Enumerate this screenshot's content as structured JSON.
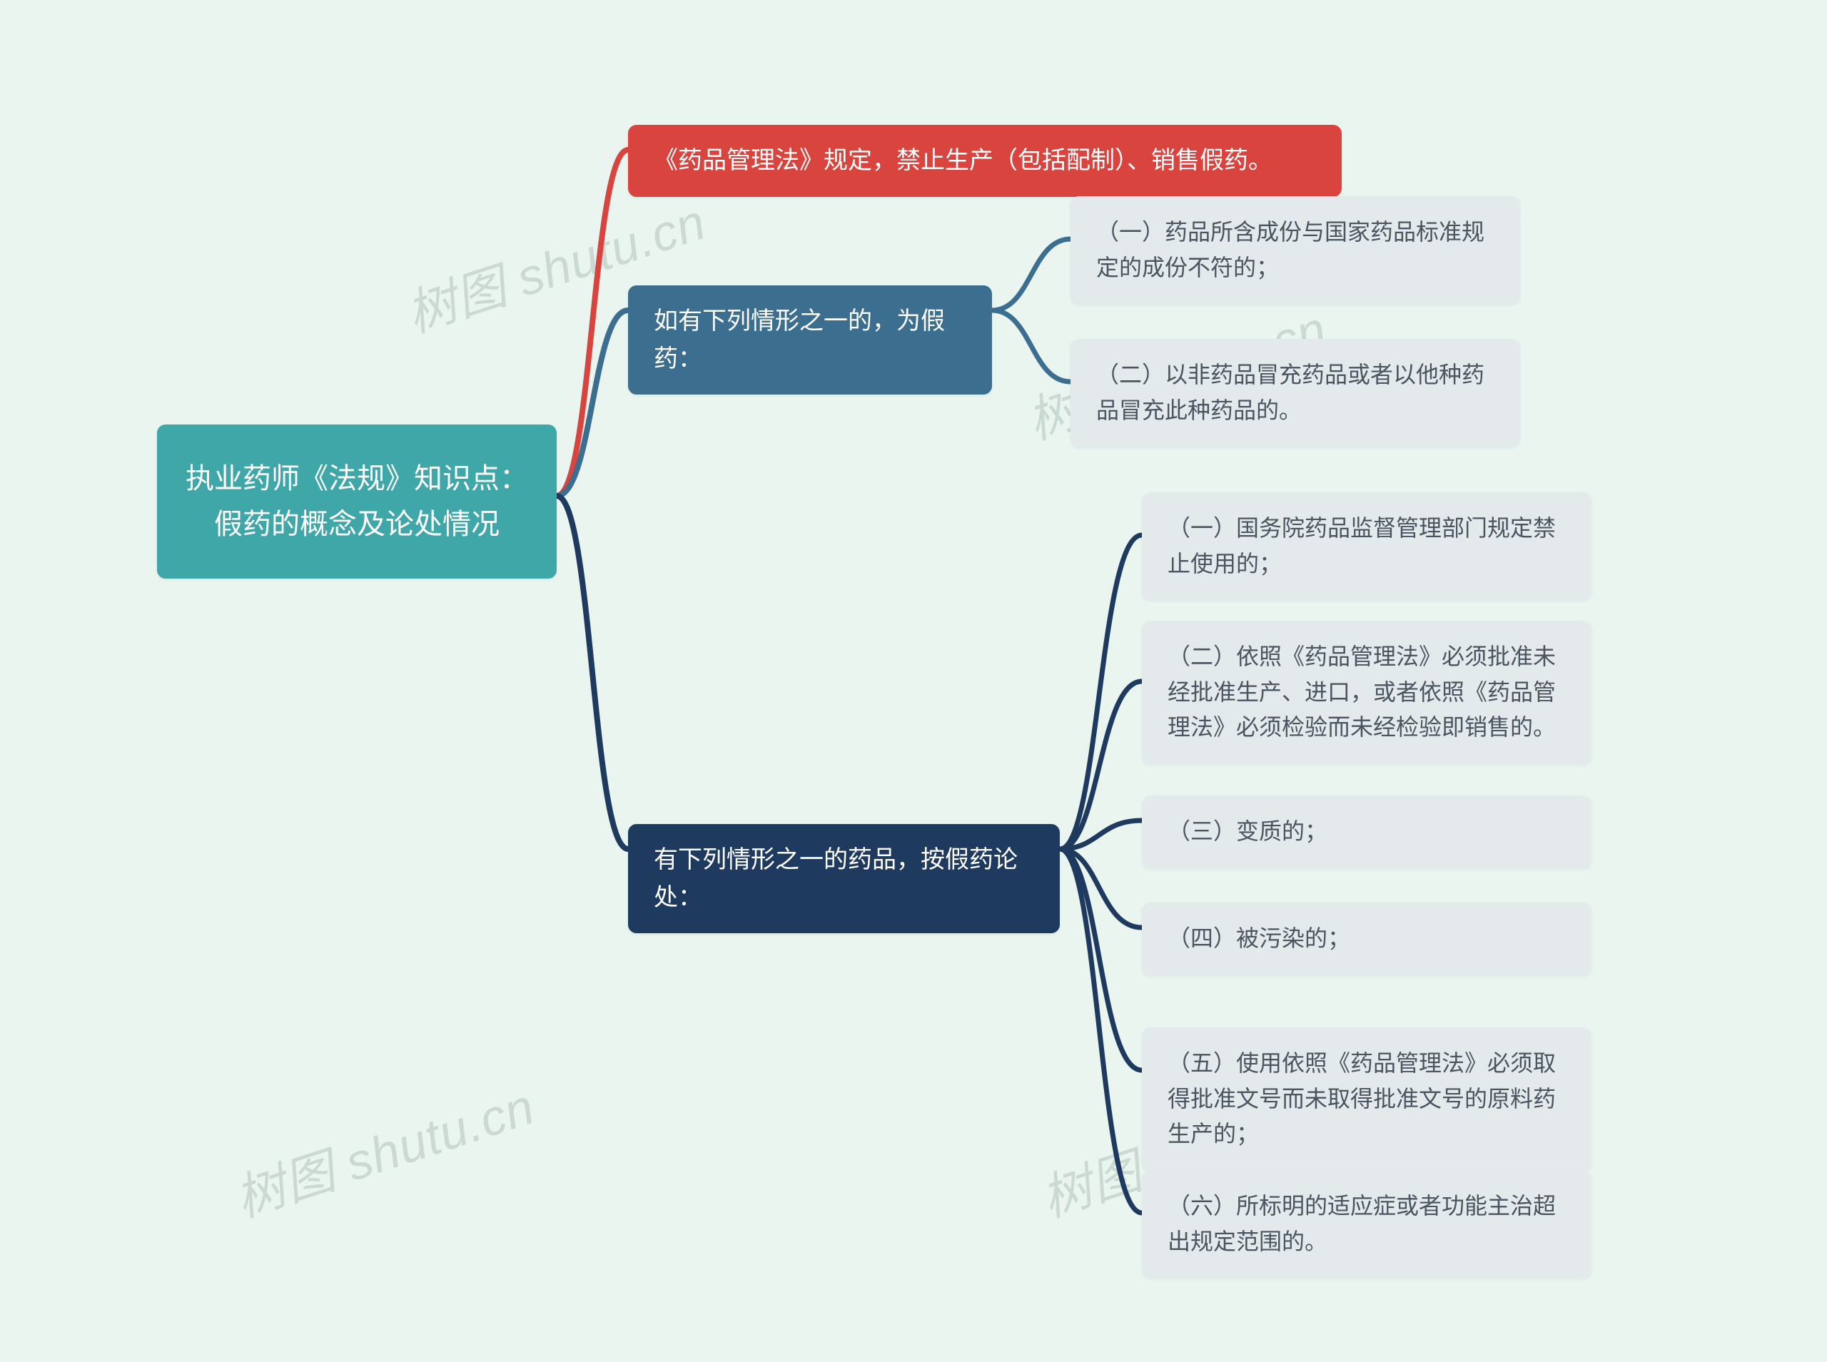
{
  "root": {
    "title": "执业药师《法规》知识点：假药的概念及论处情况"
  },
  "branches": [
    {
      "id": "b1",
      "color": "red",
      "label": "《药品管理法》规定，禁止生产（包括配制）、销售假药。",
      "children": []
    },
    {
      "id": "b2",
      "color": "blue",
      "label": "如有下列情形之一的，为假药：",
      "children": [
        {
          "id": "b2c1",
          "text": "（一）药品所含成份与国家药品标准规定的成份不符的；"
        },
        {
          "id": "b2c2",
          "text": "（二）以非药品冒充药品或者以他种药品冒充此种药品的。"
        }
      ]
    },
    {
      "id": "b3",
      "color": "navy",
      "label": "有下列情形之一的药品，按假药论处：",
      "children": [
        {
          "id": "b3c1",
          "text": "（一）国务院药品监督管理部门规定禁止使用的；"
        },
        {
          "id": "b3c2",
          "text": "（二）依照《药品管理法》必须批准未经批准生产、进口，或者依照《药品管理法》必须检验而未经检验即销售的。"
        },
        {
          "id": "b3c3",
          "text": "（三）变质的；"
        },
        {
          "id": "b3c4",
          "text": "（四）被污染的；"
        },
        {
          "id": "b3c5",
          "text": "（五）使用依照《药品管理法》必须取得批准文号而未取得批准文号的原料药生产的；"
        },
        {
          "id": "b3c6",
          "text": "（六）所标明的适应症或者功能主治超出规定范围的。"
        }
      ]
    }
  ],
  "watermarks": [
    "树图 shutu.cn",
    "树图 shutu.cn",
    "树图 shutu.cn",
    "树图 shutu.cn"
  ],
  "colors": {
    "red": "#d9443f",
    "blue": "#3c6e8f",
    "navy": "#1f3a5f",
    "bg": "#eaf5f0",
    "leaf": "#e4e9ec"
  }
}
